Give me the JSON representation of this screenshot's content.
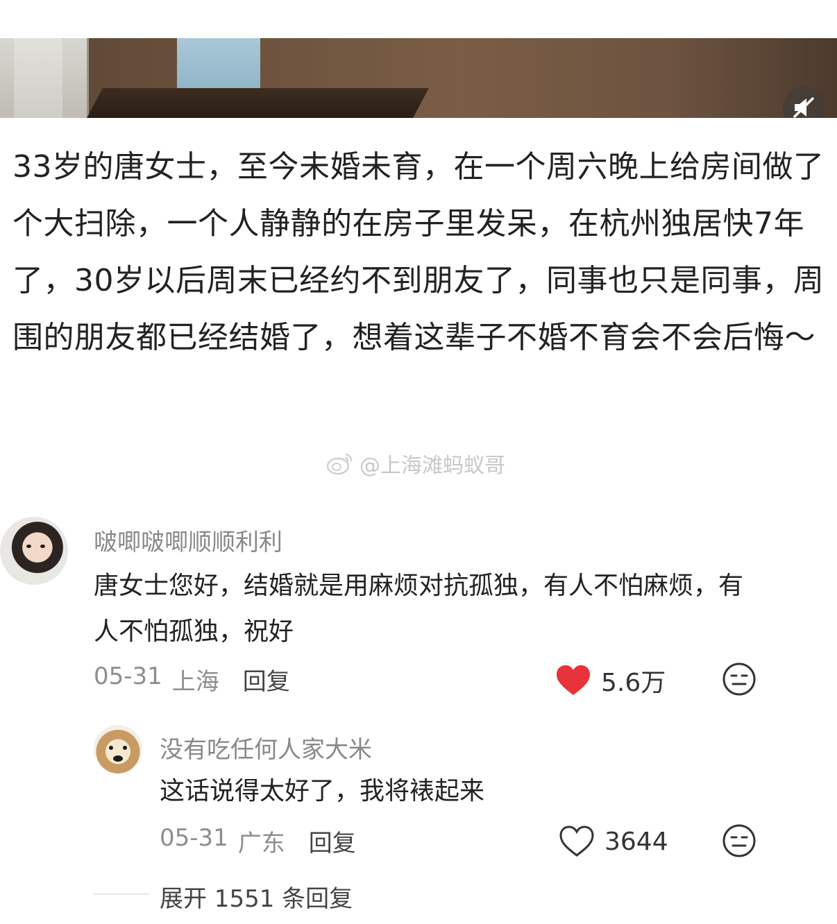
{
  "post": {
    "text": "33岁的唐女士，至今未婚未育，在一个周六晚上给房间做了个大扫除，一个人静静的在房子里发呆，在杭州独居快7年了，30岁以后周末已经约不到朋友了，同事也只是同事，周围的朋友都已经结婚了，想着这辈子不婚不育会不会后悔～",
    "watermark": "@上海滩蚂蚁哥"
  },
  "comments": [
    {
      "username": "啵唧啵唧顺顺利利",
      "text": "唐女士您好，结婚就是用麻烦对抗孤独，有人不怕麻烦，有人不怕孤独，祝好",
      "date": "05-31",
      "location": "上海",
      "reply_label": "回复",
      "likes": "5.6万",
      "liked": true
    },
    {
      "username": "没有吃任何人家大米",
      "text": "这话说得太好了，我将裱起来",
      "date": "05-31",
      "location": "广东",
      "reply_label": "回复",
      "likes": "3644",
      "liked": false
    }
  ],
  "expand_replies": "展开 1551 条回复",
  "colors": {
    "heart_liked": "#e8333a",
    "text_main": "#222222",
    "text_muted": "#8d8d8d",
    "watermark": "#c8c8c8"
  }
}
